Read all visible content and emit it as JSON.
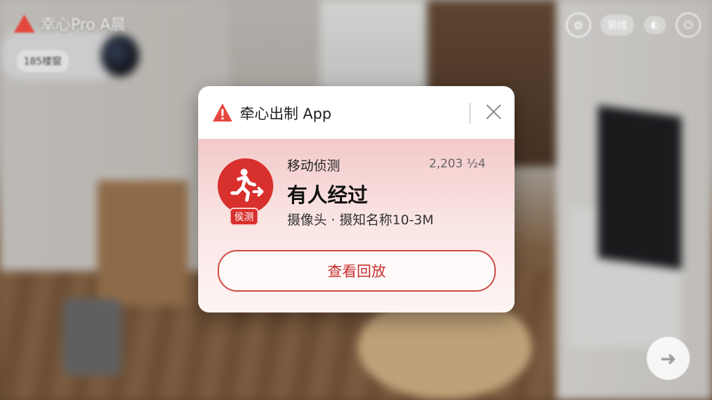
{
  "camera_view": {
    "title": "幸心Pro A晨",
    "subtitle": "185楼窗",
    "top_right_label": "邪线",
    "fab_icon": "arrow-right-icon"
  },
  "notification": {
    "app_name": "牵心出制 App",
    "close_icon": "close-icon",
    "event_type": "移动侦测",
    "event_time": "2,203 ½4",
    "event_title": "有人经过",
    "event_source": "摄像头 · 摄知名称10-3M",
    "badge_label": "侯测",
    "action_button": "查看回放",
    "colors": {
      "accent": "#d8302c",
      "warning": "#e5483f",
      "card_bg": "#ffffff"
    }
  }
}
